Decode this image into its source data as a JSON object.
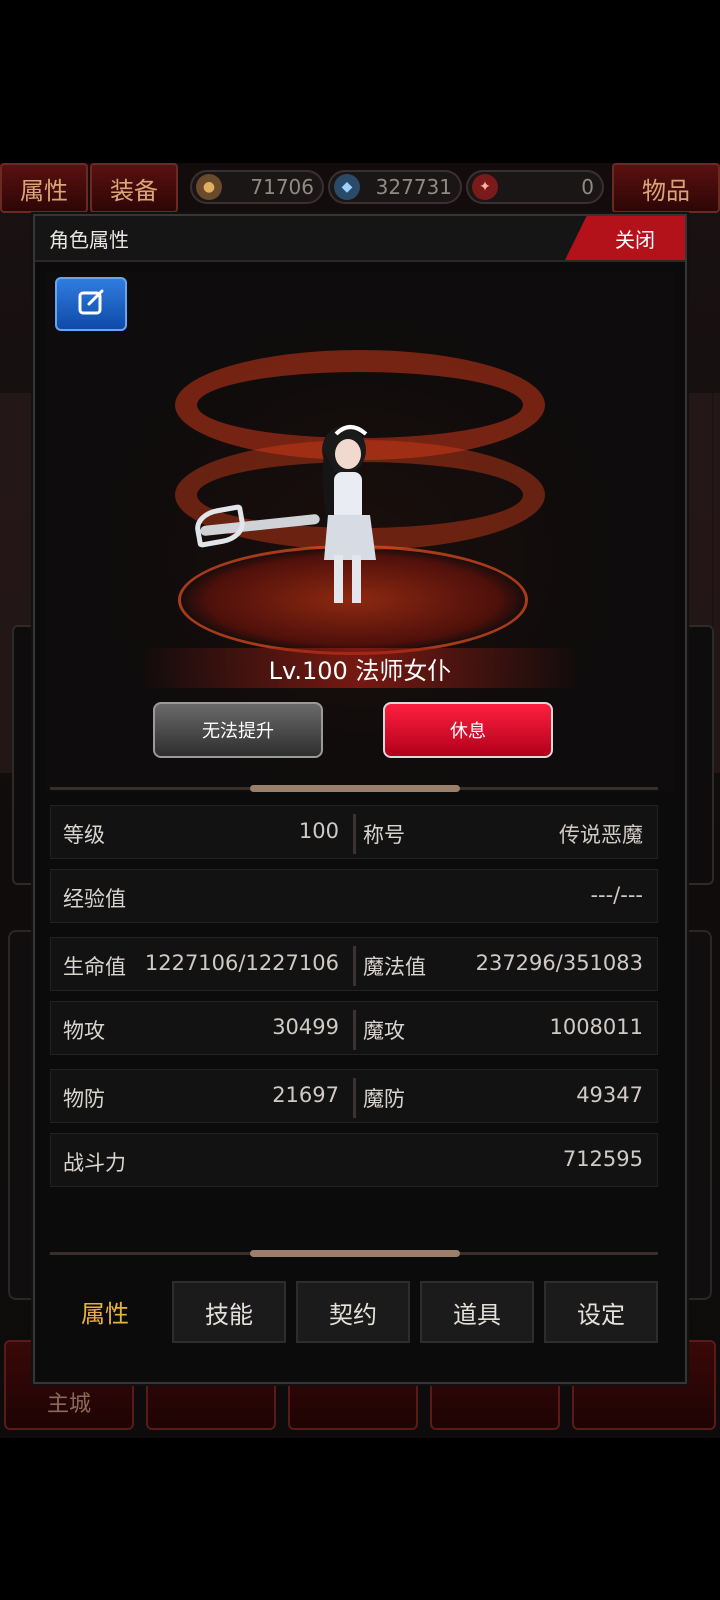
{
  "topbar": {
    "tab_attributes": "属性",
    "tab_equipment": "装备",
    "tab_items": "物品",
    "resources": [
      {
        "icon": "gold-coin-icon",
        "value": "71706"
      },
      {
        "icon": "blue-gem-icon",
        "value": "327731"
      },
      {
        "icon": "red-token-icon",
        "value": "0"
      }
    ]
  },
  "scene_nav": {
    "main_city": "主城"
  },
  "modal": {
    "title": "角色属性",
    "close_label": "关闭",
    "character_name": "Lv.100 法师女仆",
    "btn_upgrade": "无法提升",
    "btn_rest": "休息"
  },
  "stats": {
    "level_label": "等级",
    "level_value": "100",
    "title_label": "称号",
    "title_value": "传说恶魔",
    "exp_label": "经验值",
    "exp_value": "---/---",
    "hp_label": "生命值",
    "hp_value": "1227106/1227106",
    "mp_label": "魔法值",
    "mp_value": "237296/351083",
    "patk_label": "物攻",
    "patk_value": "30499",
    "matk_label": "魔攻",
    "matk_value": "1008011",
    "pdef_label": "物防",
    "pdef_value": "21697",
    "mdef_label": "魔防",
    "mdef_value": "49347",
    "power_label": "战斗力",
    "power_value": "712595"
  },
  "bottom_tabs": [
    "属性",
    "技能",
    "契约",
    "道具",
    "设定"
  ],
  "colors": {
    "accent_red": "#b3121b",
    "active_tab": "#e6b33a",
    "edit_blue": "#1f62c4"
  }
}
